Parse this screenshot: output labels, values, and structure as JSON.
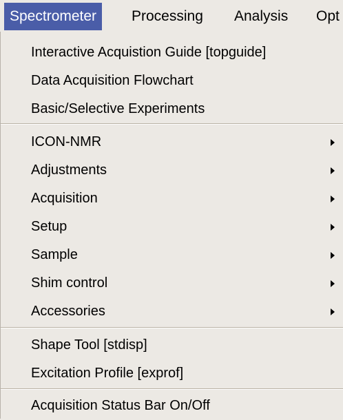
{
  "menubar": {
    "menus": [
      {
        "label": "Spectrometer"
      },
      {
        "label": "Processing"
      },
      {
        "label": "Analysis"
      },
      {
        "label": "Opt"
      }
    ]
  },
  "dropdown": {
    "items": [
      {
        "label": "Interactive Acquistion Guide [topguide]"
      },
      {
        "label": "Data Acquisition Flowchart"
      },
      {
        "label": "Basic/Selective Experiments"
      },
      {
        "label": "ICON-NMR",
        "icon": "submenu-arrow-icon"
      },
      {
        "label": "Adjustments",
        "icon": "submenu-arrow-icon"
      },
      {
        "label": "Acquisition",
        "icon": "submenu-arrow-icon"
      },
      {
        "label": "Setup",
        "icon": "submenu-arrow-icon"
      },
      {
        "label": "Sample",
        "icon": "submenu-arrow-icon"
      },
      {
        "label": "Shim control",
        "icon": "submenu-arrow-icon"
      },
      {
        "label": "Accessories",
        "icon": "submenu-arrow-icon"
      },
      {
        "label": "Shape Tool [stdisp]"
      },
      {
        "label": "Excitation Profile [exprof]"
      },
      {
        "label": "Acquisition Status Bar On/Off"
      }
    ]
  },
  "colors": {
    "menu_background": "#ece9e4",
    "active_menu_background": "#4a5da8",
    "active_menu_text": "#ffffff",
    "separator": "#b9b2a4"
  }
}
